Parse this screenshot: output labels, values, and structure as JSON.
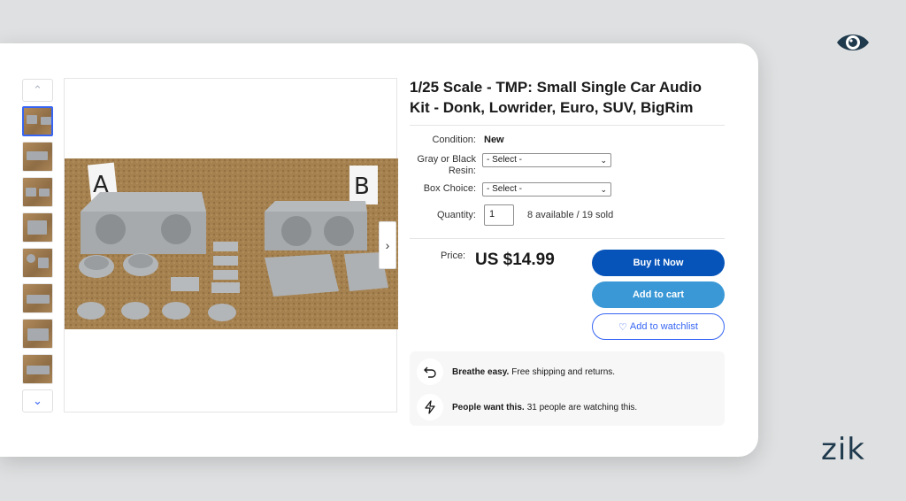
{
  "listing": {
    "title": "1/25 Scale - TMP: Small Single Car Audio Kit - Donk, Lowrider, Euro, SUV, BigRim",
    "condition_label": "Condition:",
    "condition_value": "New",
    "resin_label": "Gray or Black Resin:",
    "resin_select": "- Select -",
    "box_label": "Box Choice:",
    "box_select": "- Select -",
    "quantity_label": "Quantity:",
    "quantity_value": "1",
    "availability": "8 available / 19 sold",
    "price_label": "Price:",
    "price": "US $14.99"
  },
  "photo": {
    "box_a_label": "A",
    "box_b_label": "B"
  },
  "buttons": {
    "buy_now": "Buy It Now",
    "add_to_cart": "Add to cart",
    "watchlist": "Add to watchlist"
  },
  "perks": [
    {
      "bold": "Breathe easy.",
      "text": "Free shipping and returns.",
      "icon": "return-arrow-icon"
    },
    {
      "bold": "People want this.",
      "text": "31 people are watching this.",
      "icon": "lightning-icon"
    }
  ],
  "brand": {
    "name": "zik",
    "logo_icon": "eye-icon"
  },
  "colors": {
    "primary": "#0654ba",
    "secondary": "#3a98d6",
    "accent": "#3665f3",
    "brand": "#1f3a4d"
  }
}
